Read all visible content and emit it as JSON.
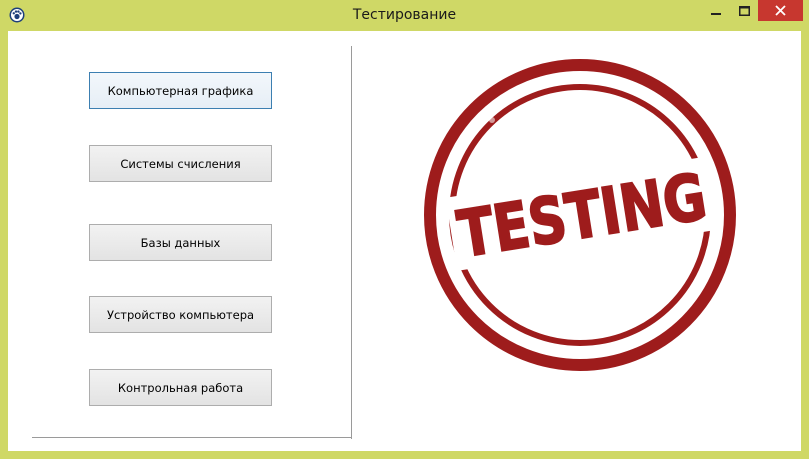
{
  "window": {
    "title": "Тестирование",
    "icon": "app-icon",
    "controls": [
      "minimize-icon",
      "maximize-icon",
      "close-icon"
    ]
  },
  "colors": {
    "frame": "#cfd866",
    "close_button": "#c7372f",
    "button_focus_border": "#3c7fb1",
    "stamp_red": "#9e1c1c"
  },
  "menu": {
    "buttons": [
      {
        "label": "Компьютерная графика",
        "focused": true
      },
      {
        "label": "Системы счисления"
      },
      {
        "label": "Базы данных"
      },
      {
        "label": "Устройство компьютера"
      },
      {
        "label": "Контрольная работа"
      }
    ]
  },
  "stamp": {
    "text": "TESTING"
  }
}
